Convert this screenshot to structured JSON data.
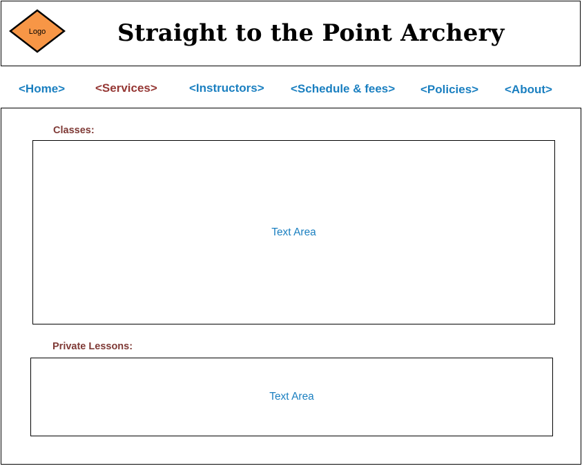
{
  "header": {
    "logo_label": "Logo",
    "logo_color": "#f79646",
    "title": "Straight to the Point Archery"
  },
  "nav": {
    "home": "<Home>",
    "services": "<Services>",
    "instructors": "<Instructors>",
    "schedule": "<Schedule & fees>",
    "policies": "<Policies>",
    "about": "<About>",
    "active": "services",
    "link_color": "#1a7fc0",
    "active_color": "#953734"
  },
  "main": {
    "classes_label": "Classes:",
    "classes_text": "Text Area",
    "private_label": "Private Lessons:",
    "private_text": "Text Area",
    "label_color": "#7f3a36"
  }
}
